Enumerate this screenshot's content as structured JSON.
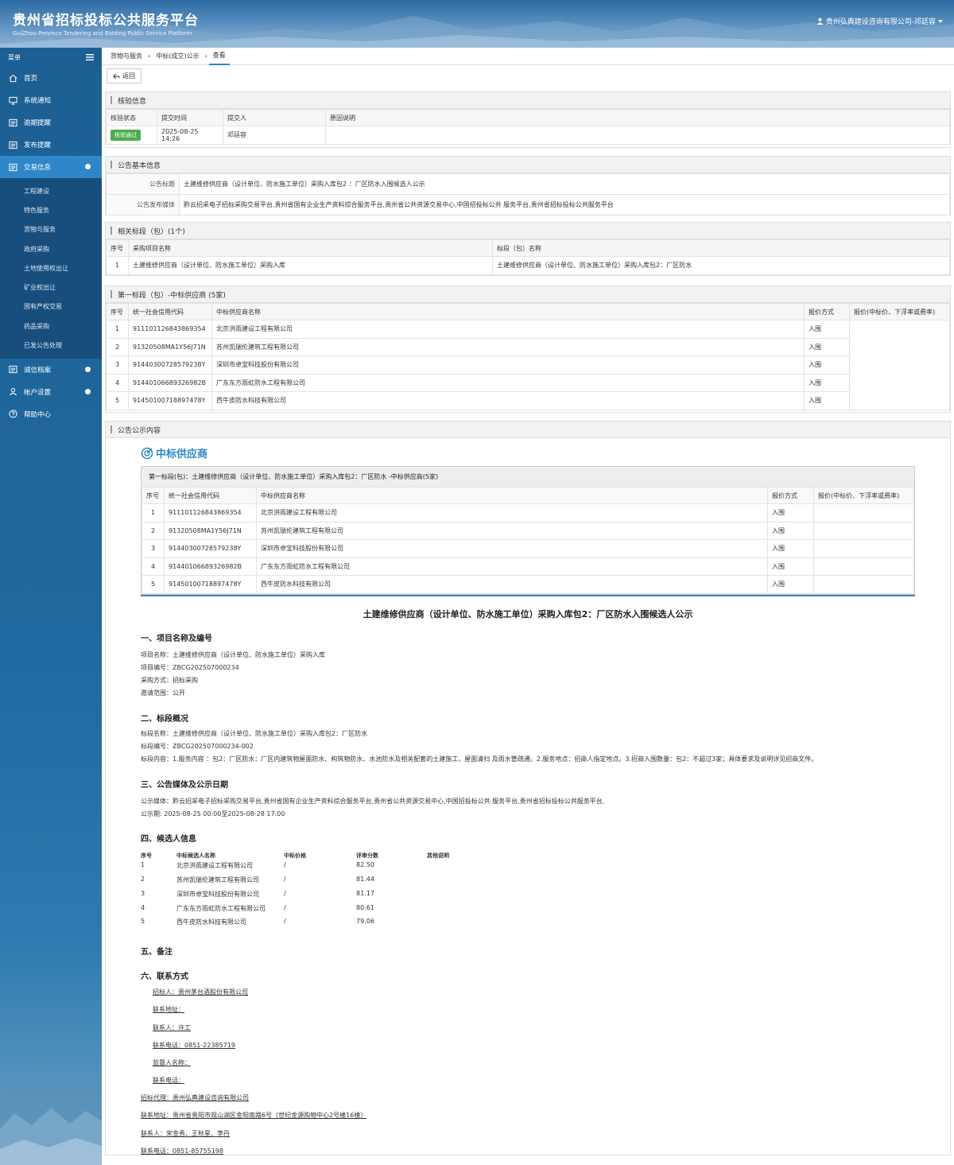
{
  "header": {
    "title_cn": "贵州省招标投标公共服务平台",
    "title_en": "GuiZhou Province Tendering and Bidding Public Service Platform",
    "user": "贵州弘典建设咨询有限公司-邓廷容"
  },
  "sidebar": {
    "menu_label": "菜单",
    "items": [
      {
        "label": "首页",
        "icon": "home-icon"
      },
      {
        "label": "系统通知",
        "icon": "monitor-icon"
      },
      {
        "label": "逾期提醒",
        "icon": "list-icon"
      },
      {
        "label": "发布提醒",
        "icon": "list-icon"
      },
      {
        "label": "交易信息",
        "icon": "list-icon"
      }
    ],
    "subitems": [
      "工程建设",
      "特色服务",
      "货物与服务",
      "政府采购",
      "土地使用权出让",
      "矿业权出让",
      "国有产权交易",
      "药品采购",
      "已发公告处理"
    ],
    "items_after": [
      {
        "label": "诚信档案",
        "icon": "list-icon"
      },
      {
        "label": "帐户设置",
        "icon": "user-icon"
      },
      {
        "label": "帮助中心",
        "icon": "help-icon"
      }
    ]
  },
  "breadcrumb": [
    "货物与服务",
    "中标(成交)公示",
    "查看"
  ],
  "toolbar": {
    "back_label": "返回"
  },
  "verify": {
    "title": "核验信息",
    "headers": [
      "核验状态",
      "提交时间",
      "提交人",
      "原因说明"
    ],
    "status": "核验通过",
    "time": "2025-08-25 14:26",
    "person": "邓廷容",
    "reason": ""
  },
  "basic": {
    "title": "公告基本信息",
    "label_title": "公告标题",
    "value_title": "土建维修供应商（设计单位、防水施工单位）采购入库包2 ：厂区防水入围候选人公示",
    "label_media": "公告发布媒体",
    "value_media": "黔云招采电子招标采购交易平台,贵州省国有企业生产资料综合服务平台,贵州省公共资源交易中心,中国招投标公共 服务平台,贵州省招标投标公共服务平台"
  },
  "sections": {
    "title": "相关标段（包）(1个)",
    "headers": [
      "序号",
      "采购项目名称",
      "标段（包）名称"
    ],
    "rows": [
      [
        "1",
        "土建维修供应商（设计单位、防水施工单位）采购入库",
        "土建维修供应商（设计单位、防水施工单位）采购入库包2：厂区防水"
      ]
    ]
  },
  "winners": {
    "title": "第一标段（包）-中标供应商 (5家)",
    "headers": [
      "序号",
      "统一社会信用代码",
      "中标供应商名称",
      "报价方式",
      "报价(中标价、下浮率或费率)"
    ],
    "rows": [
      [
        "1",
        "911101126843869354",
        "北京洪雨建设工程有限公司",
        "入围"
      ],
      [
        "2",
        "91320508MA1Y56J71N",
        "苏州凯瑞伦建筑工程有限公司",
        "入围"
      ],
      [
        "3",
        "91440300728579238Y",
        "深圳市卓宝科技股份有限公司",
        "入围"
      ],
      [
        "4",
        "91440106689326982B",
        "广东东方雨虹防水工程有限公司",
        "入围"
      ],
      [
        "5",
        "91450100718897478Y",
        "西牛皮防水科技有限公司",
        "入围"
      ]
    ]
  },
  "content": {
    "panel_title": "公告公示内容",
    "zb_heading": "中标供应商",
    "zb_box_title": "第一标段(包)：土建维修供应商（设计单位、防水施工单位）采购入库包2：厂区防水 -中标供应商(5家)",
    "zb_headers": [
      "序号",
      "统一社会信用代码",
      "中标供应商名称",
      "报价方式",
      "报价(中标价、下浮率或费率)"
    ],
    "zb_rows": [
      [
        "1",
        "911101126843869354",
        "北京洪雨建设工程有限公司",
        "入围"
      ],
      [
        "2",
        "91320508MA1Y56J71N",
        "苏州凯瑞伦建筑工程有限公司",
        "入围"
      ],
      [
        "3",
        "91440300728579238Y",
        "深圳市卓宝科技股份有限公司",
        "入围"
      ],
      [
        "4",
        "91440106689326982B",
        "广东东方雨虹防水工程有限公司",
        "入围"
      ],
      [
        "5",
        "91450100718897478Y",
        "西牛皮防水科技有限公司",
        "入围"
      ]
    ],
    "doc_title": "土建维修供应商（设计单位、防水施工单位）采购入库包2：厂区防水入围候选人公示",
    "s1": "一、项目名称及编号",
    "s1_lines": [
      "项目名称：土建维修供应商（设计单位、防水施工单位）采购入库",
      "项目编号：ZBCG202507000234",
      "采购方式：招标采购",
      " 邀请范围：公开"
    ],
    "s2": "二、标段概况",
    "s2_lines": [
      "标段名称：土建维修供应商（设计单位、防水施工单位）采购入库包2：厂区防水",
      "标段编号：ZBCG202507000234-002",
      "标段内容：1.服务内容 ：包2：厂区防水：厂区内建筑物屋面防水、构筑物防水、水池防水及相关配套的土建施工，屋面清扫 及雨水管疏通。2.服务地点：招商人指定地点。3.招商入围数量：包2：不超过3家；具体要求及说明详见招商文件。"
    ],
    "s3": "三、公告媒体及公示日期",
    "s3_lines": [
      "公示媒体：黔云招采电子招标采购交易平台,贵州省国有企业生产资料综合服务平台,贵州省公共资源交易中心,中国招投标公共 服务平台,贵州省招标投标公共服务平台,",
      "公示期: 2025-08-25 00:00至2025-08-28 17:00"
    ],
    "s4": "四、候选人信息",
    "cand_headers": [
      "序号",
      "中标候选人名称",
      "中标价格",
      "评审分数",
      "其他说明"
    ],
    "cand_rows": [
      [
        "1",
        "北京洪雨建设工程有限公司",
        "/",
        "82.50",
        ""
      ],
      [
        "2",
        "苏州凯瑞伦建筑工程有限公司",
        "/",
        "81.44",
        ""
      ],
      [
        "3",
        "深圳市卓宝科技股份有限公司",
        "/",
        "81.17",
        ""
      ],
      [
        "4",
        "广东东方雨虹防水工程有限公司",
        "/",
        "80.61",
        ""
      ],
      [
        "5",
        "西牛皮防水科技有限公司",
        "/",
        "79.06",
        ""
      ]
    ],
    "s5": "五、备注",
    "s6": "六、联系方式",
    "contact_inner": [
      "招标人：贵州茅台酒股份有限公司",
      "联系地址：",
      "联系人：许工",
      "联系电话：0851-22385719",
      "监督人名称：",
      "联系电话："
    ],
    "contact_outer": [
      "招标代理：贵州弘典建设咨询有限公司",
      "联系地址：贵州省贵阳市观山湖区金阳南路6号（世纪金源购物中心2号楼16楼）",
      "联系人：宋金秀、王秋星、李丹",
      "联系电话：0851-85755198"
    ]
  }
}
